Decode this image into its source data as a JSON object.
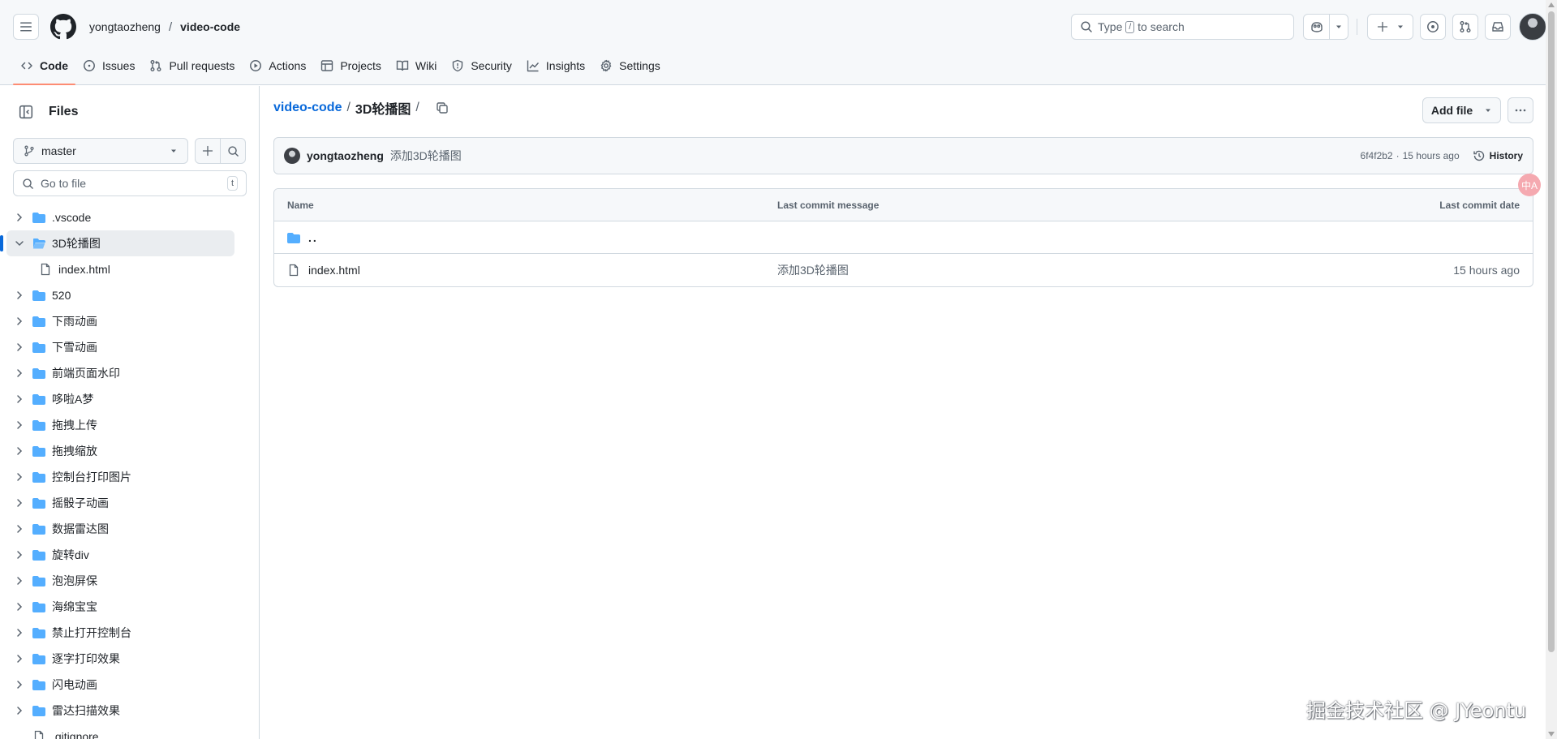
{
  "header": {
    "owner": "yongtaozheng",
    "separator": "/",
    "repo": "video-code",
    "search": {
      "prefix": "Type",
      "key": "/",
      "suffix": "to search"
    }
  },
  "nav": {
    "tabs": [
      {
        "label": "Code",
        "icon": "code-icon",
        "active": true
      },
      {
        "label": "Issues",
        "icon": "issue-icon"
      },
      {
        "label": "Pull requests",
        "icon": "pull-request-icon"
      },
      {
        "label": "Actions",
        "icon": "play-icon"
      },
      {
        "label": "Projects",
        "icon": "table-icon"
      },
      {
        "label": "Wiki",
        "icon": "book-icon"
      },
      {
        "label": "Security",
        "icon": "shield-icon"
      },
      {
        "label": "Insights",
        "icon": "graph-icon"
      },
      {
        "label": "Settings",
        "icon": "gear-icon"
      }
    ]
  },
  "sidebar": {
    "title": "Files",
    "branch": "master",
    "goto_placeholder": "Go to file",
    "goto_key": "t",
    "tree": [
      {
        "name": ".vscode",
        "type": "folder"
      },
      {
        "name": "3D轮播图",
        "type": "folder",
        "open": true,
        "selected": true
      },
      {
        "name": "index.html",
        "type": "file"
      },
      {
        "name": "520",
        "type": "folder"
      },
      {
        "name": "下雨动画",
        "type": "folder"
      },
      {
        "name": "下雪动画",
        "type": "folder"
      },
      {
        "name": "前端页面水印",
        "type": "folder"
      },
      {
        "name": "哆啦A梦",
        "type": "folder"
      },
      {
        "name": "拖拽上传",
        "type": "folder"
      },
      {
        "name": "拖拽缩放",
        "type": "folder"
      },
      {
        "name": "控制台打印图片",
        "type": "folder"
      },
      {
        "name": "摇骰子动画",
        "type": "folder"
      },
      {
        "name": "数据雷达图",
        "type": "folder"
      },
      {
        "name": "旋转div",
        "type": "folder"
      },
      {
        "name": "泡泡屏保",
        "type": "folder"
      },
      {
        "name": "海绵宝宝",
        "type": "folder"
      },
      {
        "name": "禁止打开控制台",
        "type": "folder"
      },
      {
        "name": "逐字打印效果",
        "type": "folder"
      },
      {
        "name": "闪电动画",
        "type": "folder"
      },
      {
        "name": "雷达扫描效果",
        "type": "folder"
      },
      {
        "name": ".gitignore",
        "type": "file"
      }
    ]
  },
  "main": {
    "path_root": "video-code",
    "path_sep": "/",
    "path_current": "3D轮播图",
    "path_trailing": "/",
    "add_file_label": "Add file",
    "commit": {
      "author": "yongtaozheng",
      "message": "添加3D轮播图",
      "sha": "6f4f2b2",
      "dot": "·",
      "time": "15 hours ago",
      "history_label": "History"
    },
    "table": {
      "headers": {
        "name": "Name",
        "message": "Last commit message",
        "date": "Last commit date"
      },
      "parent": "..",
      "rows": [
        {
          "name": "index.html",
          "message": "添加3D轮播图",
          "date": "15 hours ago"
        }
      ]
    }
  },
  "watermark": "掘金技术社区 @ JYeontu",
  "translate_badge": "中A",
  "colors": {
    "accent": "#0969da",
    "nav_underline": "#fd8c73",
    "folder": "#54aeff"
  }
}
